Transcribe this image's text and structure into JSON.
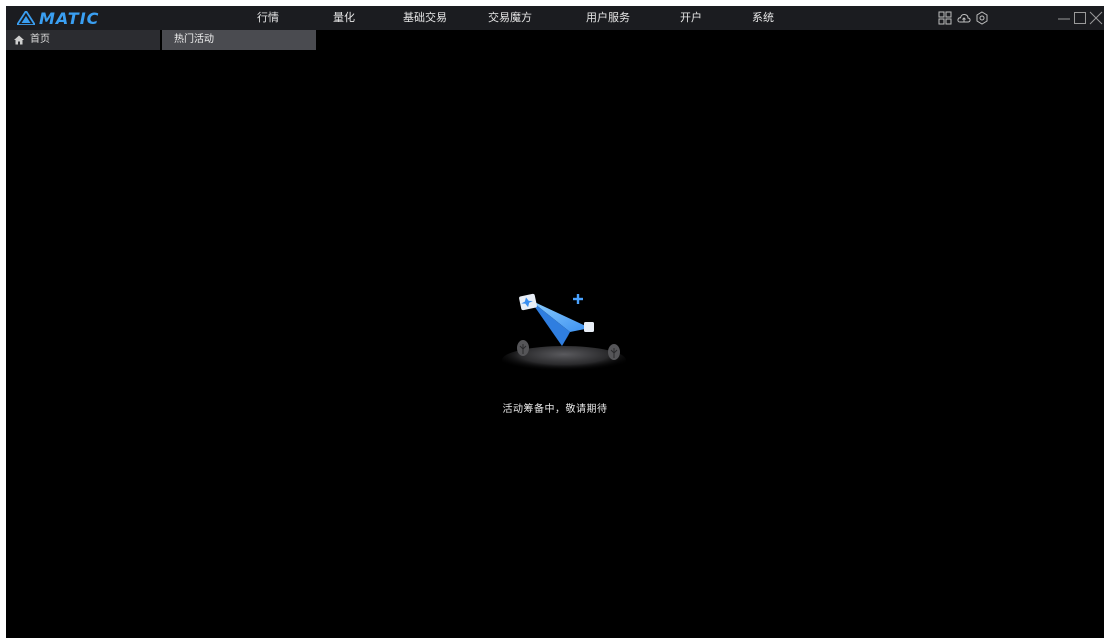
{
  "app": {
    "name": "MATIC",
    "brand_color": "#3a9ff2"
  },
  "menu": {
    "items": [
      {
        "label": "行情"
      },
      {
        "label": "量化"
      },
      {
        "label": "基础交易"
      },
      {
        "label": "交易魔方"
      },
      {
        "label": "用户服务"
      },
      {
        "label": "开户"
      },
      {
        "label": "系统"
      }
    ]
  },
  "toolbar_icons": [
    "grid-icon",
    "cloud-icon",
    "settings-icon"
  ],
  "window_controls": [
    "minimize-icon",
    "maximize-icon",
    "close-icon"
  ],
  "tabs": [
    {
      "label": "首页",
      "icon": "home-icon"
    },
    {
      "label": "热门活动",
      "active": true
    }
  ],
  "content": {
    "empty_message": "活动筹备中，敬请期待",
    "illustration": "paper-plane-icon"
  }
}
